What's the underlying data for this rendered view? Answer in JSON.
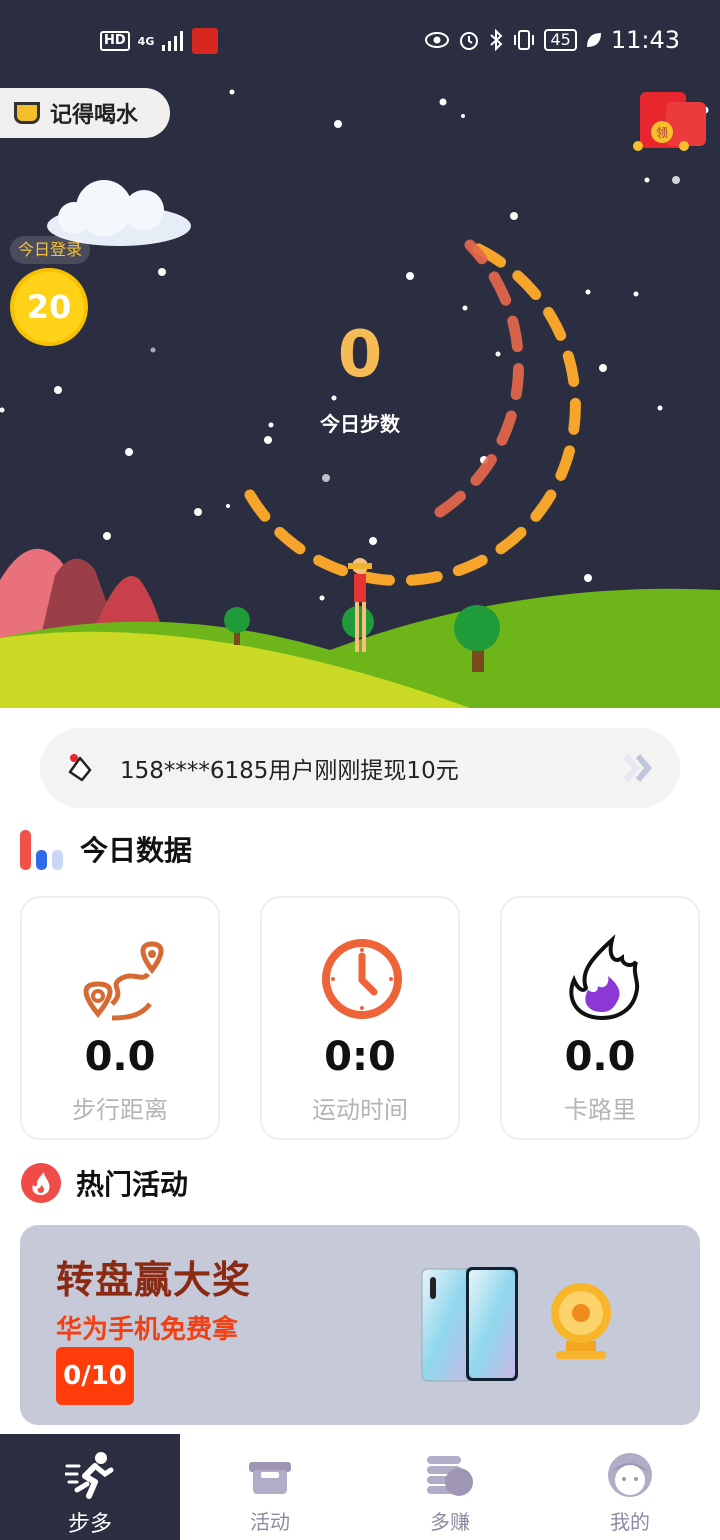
{
  "status_bar": {
    "hd": "HD",
    "net": "4G",
    "battery": "45",
    "time": "11:43"
  },
  "hero": {
    "drink_label": "记得喝水",
    "login_badge": "今日登录",
    "login_coins": "20",
    "steps_value": "0",
    "steps_label": "今日步数",
    "red_bag_label": "领"
  },
  "ticker": {
    "text": "158****6185用户刚刚提现10元"
  },
  "today_data": {
    "title": "今日数据",
    "cards": [
      {
        "value": "0.0",
        "label": "步行距离",
        "icon": "route-icon"
      },
      {
        "value": "0:0",
        "label": "运动时间",
        "icon": "clock-icon"
      },
      {
        "value": "0.0",
        "label": "卡路里",
        "icon": "flame-icon"
      }
    ]
  },
  "hot_activity": {
    "title": "热门活动",
    "banner_title": "转盘赢大奖",
    "banner_subtitle": "华为手机免费拿",
    "banner_progress": "0/10"
  },
  "nav": {
    "items": [
      {
        "label": "步多",
        "icon": "runner-icon",
        "active": true
      },
      {
        "label": "活动",
        "icon": "gift-box-icon",
        "active": false
      },
      {
        "label": "多赚",
        "icon": "coins-stack-icon",
        "active": false
      },
      {
        "label": "我的",
        "icon": "profile-face-icon",
        "active": false
      }
    ]
  },
  "colors": {
    "hero_bg": "#2b2d40",
    "steps_accent": "#f5bb55",
    "arc_orange": "#f4a52a",
    "arc_red": "#e8684a",
    "banner_bg": "#c6cad8",
    "banner_red": "#ff3c0a"
  }
}
